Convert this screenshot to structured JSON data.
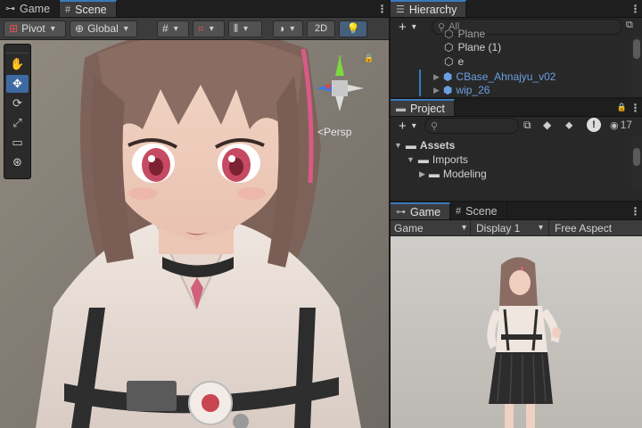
{
  "scene_panel": {
    "tabs": [
      {
        "label": "Game",
        "icon": "gamepad-icon"
      },
      {
        "label": "Scene",
        "icon": "grid-icon"
      }
    ],
    "toolbar": {
      "pivot": "Pivot",
      "global": "Global",
      "mode_2d": "2D"
    },
    "tools": [
      "hand-tool",
      "move-tool",
      "rotate-tool",
      "scale-tool",
      "rect-tool",
      "transform-tool"
    ],
    "gizmo": {
      "persp_label": "Persp",
      "y_axis": "y"
    }
  },
  "hierarchy": {
    "tab_label": "Hierarchy",
    "search_placeholder": "All",
    "items": [
      {
        "label": "Plane",
        "type": "gameobject",
        "partial": true
      },
      {
        "label": "Plane (1)",
        "type": "gameobject"
      },
      {
        "label": "e",
        "type": "gameobject"
      },
      {
        "label": "CBase_Ahnajyu_v02",
        "type": "prefab"
      },
      {
        "label": "wip_26",
        "type": "prefab"
      }
    ]
  },
  "project": {
    "tab_label": "Project",
    "visible_count": "17",
    "tree": [
      {
        "label": "Assets",
        "bold": true
      },
      {
        "label": "Imports"
      },
      {
        "label": "Modeling"
      }
    ]
  },
  "game_panel": {
    "tabs": [
      {
        "label": "Game",
        "icon": "gamepad-icon"
      },
      {
        "label": "Scene",
        "icon": "grid-icon"
      }
    ],
    "display_mode": "Game",
    "display": "Display 1",
    "aspect": "Free Aspect"
  },
  "colors": {
    "accent_blue": "#3a79bb",
    "prefab_blue": "#6b9fe0",
    "panel_bg": "#282828",
    "toolbar_bg": "#3c3c3c"
  }
}
